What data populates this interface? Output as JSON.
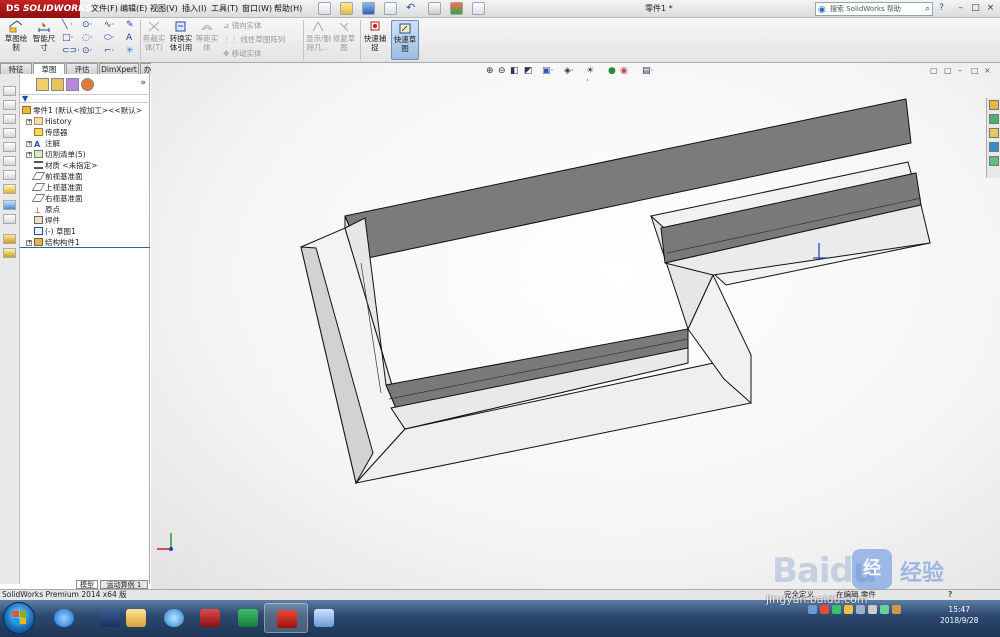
{
  "app": {
    "logo": "SOLIDWORKS",
    "logo_mark": "DS",
    "menus": [
      "文件(F)",
      "编辑(E)",
      "视图(V)",
      "插入(I)",
      "工具(T)",
      "窗口(W)",
      "帮助(H)"
    ],
    "document_title": "零件1 *",
    "search_placeholder": "搜索 SolidWorks 帮助",
    "help_btn": "?",
    "window_controls": [
      "–",
      "□",
      "×"
    ]
  },
  "ribbon": {
    "buttons": [
      {
        "id": "sketch",
        "label": "草图绘\n制",
        "dim": false
      },
      {
        "id": "smart-dim",
        "label": "智能尺\n寸",
        "dim": false
      },
      {
        "id": "trim",
        "label": "剪裁实\n体(T)",
        "dim": true
      },
      {
        "id": "convert",
        "label": "转换实\n体引用",
        "dim": false
      },
      {
        "id": "offset",
        "label": "等距实\n体",
        "dim": true
      },
      {
        "id": "mirror",
        "label": "镜向实体",
        "dim": true
      },
      {
        "id": "linear-pattern",
        "label": "线性草图阵列",
        "dim": true
      },
      {
        "id": "move",
        "label": "移动实体",
        "dim": true
      },
      {
        "id": "display-delete",
        "label": "显示/删\n除几...",
        "dim": true
      },
      {
        "id": "repair",
        "label": "修复草\n图",
        "dim": true
      },
      {
        "id": "quick-snap",
        "label": "快速捕\n捉",
        "dim": false
      },
      {
        "id": "quick-view",
        "label": "快速草\n图",
        "dim": false
      }
    ]
  },
  "tabs": [
    "特征",
    "草图",
    "评估",
    "DimXpert",
    "办公室产品"
  ],
  "active_tab": "草图",
  "feature_tree": {
    "root": "零件1 (默认<按加工><<默认>",
    "nodes": [
      {
        "label": "History",
        "expand": "+"
      },
      {
        "label": "传感器",
        "expand": ""
      },
      {
        "label": "注解",
        "expand": "+"
      },
      {
        "label": "切割清单(5)",
        "expand": "+"
      },
      {
        "label": "材质 <未指定>",
        "expand": ""
      },
      {
        "label": "前视基准面",
        "expand": ""
      },
      {
        "label": "上视基准面",
        "expand": ""
      },
      {
        "label": "右视基准面",
        "expand": ""
      },
      {
        "label": "原点",
        "expand": ""
      },
      {
        "label": "焊件",
        "expand": ""
      },
      {
        "label": "(-) 草图1",
        "expand": ""
      },
      {
        "label": "结构构件1",
        "expand": "+"
      }
    ]
  },
  "bottom_tabs": [
    "模型",
    "运动算例 1"
  ],
  "status": {
    "left": "SolidWorks Premium 2014 x64 版",
    "right1": "完全定义",
    "right2": "在编辑 零件",
    "help": "?"
  },
  "taskbar": {
    "time": "15:47",
    "date": "2018/9/28"
  },
  "watermark": {
    "brand": "Baidu",
    "badge": "经",
    "jingyan": "经验",
    "url": "jingyan.baidu.com"
  }
}
